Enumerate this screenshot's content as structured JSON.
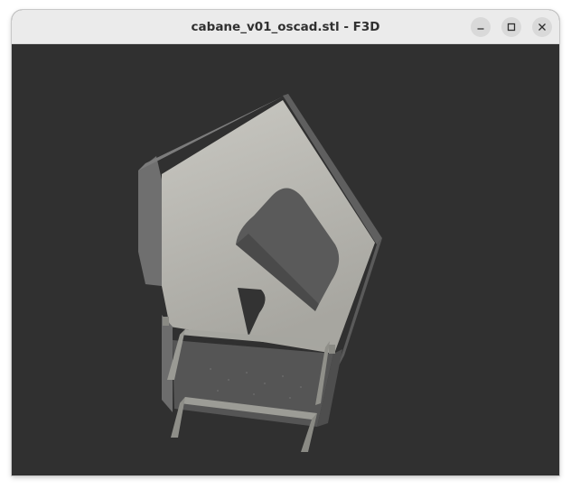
{
  "window": {
    "title": "cabane_v01_oscad.stl - F3D"
  },
  "controls": {
    "minimize": "minimize-icon",
    "maximize": "maximize-icon",
    "close": "close-icon"
  },
  "viewport": {
    "background_color": "#303030",
    "model_color": "#b8b8b2"
  }
}
